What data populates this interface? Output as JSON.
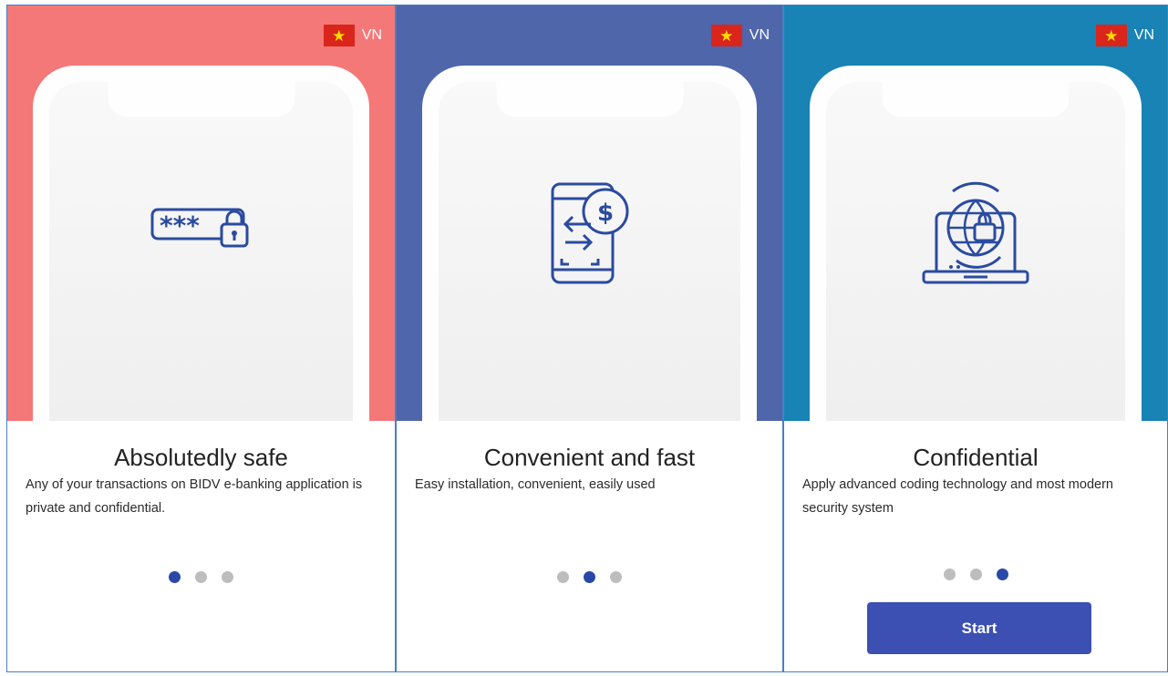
{
  "language": {
    "code": "VN",
    "flag_symbol": "★"
  },
  "slides": [
    {
      "hero_color": "#f47878",
      "icon": "password-lock-icon",
      "title": "Absolutedly safe",
      "description": "Any of your transactions on BIDV e-banking application is private and confidential.",
      "page_indicator": {
        "current": 1,
        "total": 3
      }
    },
    {
      "hero_color": "#4f66ab",
      "icon": "mobile-money-exchange-icon",
      "title": "Convenient and fast",
      "description": "Easy installation, convenient, easily used",
      "page_indicator": {
        "current": 2,
        "total": 3
      }
    },
    {
      "hero_color": "#1883b4",
      "icon": "laptop-globe-lock-icon",
      "title": "Confidential",
      "description": "Apply advanced coding technology and most modern security system",
      "page_indicator": {
        "current": 3,
        "total": 3
      },
      "start_label": "Start"
    }
  ],
  "colors": {
    "icon_blue": "#2a4ba0",
    "dot_active": "#2a48a8",
    "dot_inactive": "#bdbdbd",
    "button": "#3c4fb2"
  }
}
